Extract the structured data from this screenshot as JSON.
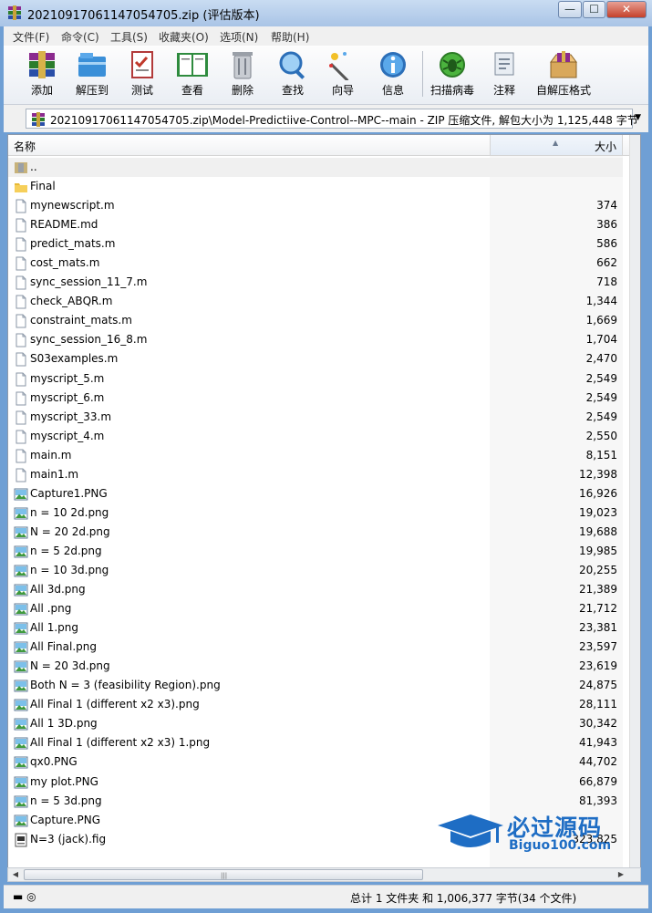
{
  "window": {
    "title": "20210917061147054705.zip (评估版本)"
  },
  "title_buttons": {
    "minimize": "—",
    "maximize": "☐",
    "close": "✕"
  },
  "menu": [
    "文件(F)",
    "命令(C)",
    "工具(S)",
    "收藏夹(O)",
    "选项(N)",
    "帮助(H)"
  ],
  "toolbar": [
    {
      "label": "添加",
      "icon": "add-archive-icon"
    },
    {
      "label": "解压到",
      "icon": "extract-to-icon"
    },
    {
      "label": "测试",
      "icon": "test-icon"
    },
    {
      "label": "查看",
      "icon": "view-icon"
    },
    {
      "label": "删除",
      "icon": "delete-icon"
    },
    {
      "label": "查找",
      "icon": "find-icon"
    },
    {
      "label": "向导",
      "icon": "wizard-icon"
    },
    {
      "label": "信息",
      "icon": "info-icon"
    },
    {
      "label": "扫描病毒",
      "icon": "virus-scan-icon"
    },
    {
      "label": "注释",
      "icon": "comment-icon"
    },
    {
      "label": "自解压格式",
      "icon": "sfx-icon"
    }
  ],
  "address": {
    "path": "20210917061147054705.zip\\Model-Predictiive-Control--MPC--main - ZIP 压缩文件, 解包大小为 1,125,448 字节"
  },
  "columns": {
    "name": "名称",
    "size": "大小"
  },
  "files": [
    {
      "name": "..",
      "size": "",
      "type": "parent"
    },
    {
      "name": "Final",
      "size": "",
      "type": "folder"
    },
    {
      "name": "mynewscript.m",
      "size": "374",
      "type": "file"
    },
    {
      "name": "README.md",
      "size": "386",
      "type": "file"
    },
    {
      "name": "predict_mats.m",
      "size": "586",
      "type": "file"
    },
    {
      "name": "cost_mats.m",
      "size": "662",
      "type": "file"
    },
    {
      "name": "sync_session_11_7.m",
      "size": "718",
      "type": "file"
    },
    {
      "name": "check_ABQR.m",
      "size": "1,344",
      "type": "file"
    },
    {
      "name": "constraint_mats.m",
      "size": "1,669",
      "type": "file"
    },
    {
      "name": "sync_session_16_8.m",
      "size": "1,704",
      "type": "file"
    },
    {
      "name": "S03examples.m",
      "size": "2,470",
      "type": "file"
    },
    {
      "name": "myscript_5.m",
      "size": "2,549",
      "type": "file"
    },
    {
      "name": "myscript_6.m",
      "size": "2,549",
      "type": "file"
    },
    {
      "name": "myscript_33.m",
      "size": "2,549",
      "type": "file"
    },
    {
      "name": "myscript_4.m",
      "size": "2,550",
      "type": "file"
    },
    {
      "name": "main.m",
      "size": "8,151",
      "type": "file"
    },
    {
      "name": "main1.m",
      "size": "12,398",
      "type": "file"
    },
    {
      "name": "Capture1.PNG",
      "size": "16,926",
      "type": "image"
    },
    {
      "name": "n = 10 2d.png",
      "size": "19,023",
      "type": "image"
    },
    {
      "name": "N = 20 2d.png",
      "size": "19,688",
      "type": "image"
    },
    {
      "name": "n = 5 2d.png",
      "size": "19,985",
      "type": "image"
    },
    {
      "name": "n = 10 3d.png",
      "size": "20,255",
      "type": "image"
    },
    {
      "name": "All 3d.png",
      "size": "21,389",
      "type": "image"
    },
    {
      "name": "All .png",
      "size": "21,712",
      "type": "image"
    },
    {
      "name": "All 1.png",
      "size": "23,381",
      "type": "image"
    },
    {
      "name": "All Final.png",
      "size": "23,597",
      "type": "image"
    },
    {
      "name": "N = 20 3d.png",
      "size": "23,619",
      "type": "image"
    },
    {
      "name": "Both N = 3 (feasibility Region).png",
      "size": "24,875",
      "type": "image"
    },
    {
      "name": "All Final 1 (different x2 x3).png",
      "size": "28,111",
      "type": "image"
    },
    {
      "name": "All 1 3D.png",
      "size": "30,342",
      "type": "image"
    },
    {
      "name": "All Final 1 (different x2 x3) 1.png",
      "size": "41,943",
      "type": "image"
    },
    {
      "name": "qx0.PNG",
      "size": "44,702",
      "type": "image"
    },
    {
      "name": "my plot.PNG",
      "size": "66,879",
      "type": "image"
    },
    {
      "name": "n = 5 3d.png",
      "size": "81,393",
      "type": "image"
    },
    {
      "name": "Capture.PNG",
      "size": "",
      "type": "image"
    },
    {
      "name": "N=3 (jack).fig",
      "size": "323,825",
      "type": "fig"
    }
  ],
  "status": {
    "summary": "总计 1 文件夹 和 1,006,377 字节(34 个文件)"
  },
  "watermark": {
    "title": "必过源码",
    "subtitle": "Biguo100.com"
  },
  "colors": {
    "accent": "#1e6dc4",
    "frame": "#6f9fd4"
  }
}
